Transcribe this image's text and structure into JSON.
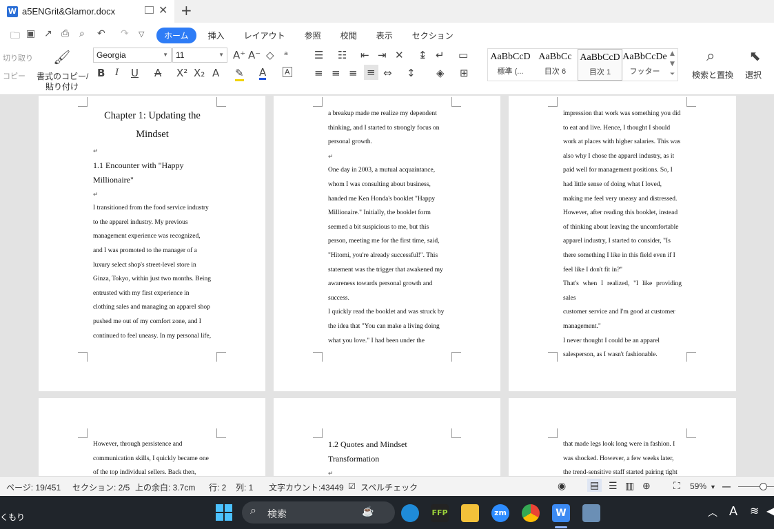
{
  "window": {
    "tab_title": "a5ENGrit&Glamor.docx",
    "app_icon": "W"
  },
  "ribbon": {
    "tabs": [
      "ホーム",
      "挿入",
      "レイアウト",
      "参照",
      "校閲",
      "表示",
      "セクション"
    ],
    "cut_label": "切り取り",
    "copy_label": "コピー",
    "format_painter_line1": "書式のコピー/",
    "format_painter_line2": "貼り付け",
    "font_name": "Georgia",
    "font_size": "11",
    "styles": [
      {
        "sample": "AaBbCcD",
        "name": "標準 (..."
      },
      {
        "sample": "AaBbCc",
        "name": "目次 6"
      },
      {
        "sample": "AaBbCcD",
        "name": "目次 1"
      },
      {
        "sample": "AaBbCcDe",
        "name": "フッター"
      }
    ],
    "find_replace_label": "検索と置換",
    "select_label": "選択"
  },
  "pages": {
    "p1": {
      "chapter_line1": "Chapter 1: Updating the",
      "chapter_line2": "Mindset",
      "section_line1": "1.1 Encounter with \"Happy",
      "section_line2": "Millionaire\"",
      "lines": [
        "I transitioned from the food service industry",
        "to the apparel industry. My previous",
        "management experience was recognized,",
        "and I was promoted to the manager of a",
        "luxury select shop's street-level store in",
        "Ginza, Tokyo, within just two months. Being",
        "entrusted with my first experience in",
        "clothing sales and managing an apparel shop",
        "pushed me out of my comfort zone, and I",
        "continued to feel uneasy. In my personal life,"
      ]
    },
    "p2": {
      "lines_a": [
        "a breakup made me realize my dependent",
        "thinking, and I started to strongly focus on",
        "personal growth."
      ],
      "lines_b": [
        "One day in 2003, a mutual acquaintance,",
        "whom I was consulting about business,",
        "handed me Ken Honda's booklet \"Happy",
        "Millionaire.\" Initially, the booklet form",
        "seemed a bit suspicious to me, but this",
        "person, meeting me for the first time, said,",
        "\"Hitomi, you're already successful!\". This",
        "statement was the trigger that awakened my",
        "awareness towards personal growth and",
        "success.",
        "I quickly read the booklet and was struck by",
        "the idea that \"You can make a living doing",
        "what you love.\" I had been under the"
      ]
    },
    "p3": {
      "lines": [
        "impression that work was something you did",
        "to eat and live. Hence, I thought I should",
        "work at places with higher salaries. This was",
        "also why I chose the apparel industry, as it",
        "paid well for management positions. So, I",
        "had little sense of doing what I loved,",
        "making me feel very uneasy and distressed.",
        "However, after reading this booklet, instead",
        "of thinking about leaving the uncomfortable",
        "apparel industry, I started to consider, \"Is",
        "there something I like in this field even if I",
        "feel like I don't fit in?\"",
        "That's when I realized, \"I like providing sales",
        "customer service and I'm good at customer",
        "management.\"",
        "I never thought I could be an apparel",
        "salesperson, as I wasn't fashionable."
      ]
    },
    "p4": {
      "lines": [
        "However, through persistence and",
        "communication skills, I quickly became one",
        "of the top individual sellers. Back then,"
      ]
    },
    "p5": {
      "section_line1": "1.2 Quotes and Mindset",
      "section_line2": "Transformation"
    },
    "p6": {
      "lines": [
        "that made legs look long were in fashion. I",
        "was shocked. However, a few weeks later,",
        "the trend-sensitive staff started pairing tight"
      ]
    }
  },
  "status": {
    "page": "ページ: 19/451",
    "section": "セクション: 2/5",
    "margin": "上の余白: 3.7cm",
    "line": "行: 2",
    "column": "列: 1",
    "word_count": "文字カウント:43449",
    "spellcheck": "スペルチェック",
    "zoom": "59%"
  },
  "taskbar": {
    "weather": "くもり",
    "search_placeholder": "検索"
  }
}
